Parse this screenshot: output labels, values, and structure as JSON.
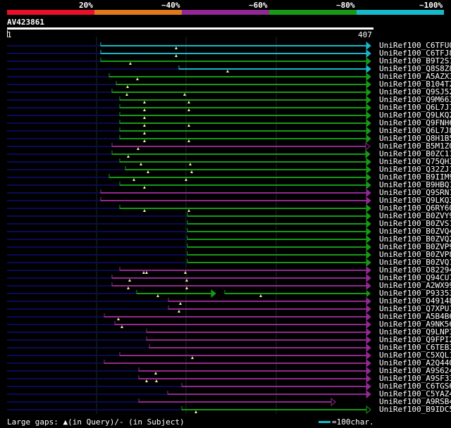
{
  "legend": {
    "items": [
      {
        "label": "20%",
        "color": "#e8102a"
      },
      {
        "label": "~40%",
        "color": "#e07a1a"
      },
      {
        "label": "~60%",
        "color": "#922892"
      },
      {
        "label": "~80%",
        "color": "#169a16"
      },
      {
        "label": "~100%",
        "color": "#17b8c8"
      }
    ]
  },
  "query": {
    "id": "AV423861",
    "start": "1",
    "end": "407"
  },
  "colors": {
    "navy": "#0a0a55",
    "green": "#169a16",
    "purple": "#922892",
    "cyan": "#17b8c8",
    "marker": "#f0f0a0"
  },
  "hits": [
    {
      "name": "UniRef100_C6TFU0",
      "color": "cyan",
      "start": 143,
      "markers": [
        250
      ]
    },
    {
      "name": "UniRef100_C6TFJ8",
      "color": "cyan",
      "start": 143,
      "markers": [
        250
      ]
    },
    {
      "name": "UniRef100_B9T2S1",
      "color": "green",
      "start": 143,
      "markers": [
        185
      ]
    },
    {
      "name": "UniRef100_Q8S8Z8",
      "color": "cyan",
      "start": 254,
      "markers": [
        323
      ]
    },
    {
      "name": "UniRef100_A5AZX3",
      "color": "green",
      "start": 155,
      "markers": [
        195
      ]
    },
    {
      "name": "UniRef100_B104T2",
      "color": "green",
      "start": 165,
      "markers": [
        181
      ]
    },
    {
      "name": "UniRef100_Q9SJ52",
      "color": "green",
      "start": 159,
      "markers": [
        180,
        262
      ]
    },
    {
      "name": "UniRef100_Q9M663",
      "color": "green",
      "start": 170,
      "markers": [
        205,
        268
      ]
    },
    {
      "name": "UniRef100_Q6L7J7",
      "color": "green",
      "start": 170,
      "markers": [
        205,
        268
      ]
    },
    {
      "name": "UniRef100_Q9LKQ2",
      "color": "green",
      "start": 170,
      "markers": [
        205
      ]
    },
    {
      "name": "UniRef100_Q9FNH6",
      "color": "green",
      "start": 170,
      "markers": [
        205,
        268
      ]
    },
    {
      "name": "UniRef100_Q6L7J8",
      "color": "green",
      "start": 170,
      "markers": [
        205
      ]
    },
    {
      "name": "UniRef100_Q8H1B5",
      "color": "green",
      "start": 170,
      "markers": [
        205,
        268
      ]
    },
    {
      "name": "UniRef100_B5M1Z0",
      "color": "purple",
      "start": 159,
      "end": 519,
      "open": true,
      "markers": [
        196
      ]
    },
    {
      "name": "UniRef100_B0ZC11",
      "color": "green",
      "start": 159,
      "end": 519,
      "markers": [
        182
      ]
    },
    {
      "name": "UniRef100_Q75QH3",
      "color": "green",
      "start": 170,
      "markers": [
        200,
        270
      ]
    },
    {
      "name": "UniRef100_Q32ZJ1",
      "color": "green",
      "start": 178,
      "markers": [
        210,
        272
      ]
    },
    {
      "name": "UniRef100_B9IIM9",
      "color": "green",
      "start": 155,
      "markers": [
        190,
        264
      ]
    },
    {
      "name": "UniRef100_B9HBQ1",
      "color": "green",
      "start": 170,
      "markers": [
        205
      ]
    },
    {
      "name": "UniRef100_Q9SRN1",
      "color": "purple",
      "start": 143,
      "markers": []
    },
    {
      "name": "UniRef100_Q9LKQ3",
      "color": "purple",
      "start": 143,
      "markers": []
    },
    {
      "name": "UniRef100_Q6RY60",
      "color": "green",
      "start": 170,
      "markers": [
        205,
        268
      ]
    },
    {
      "name": "UniRef100_B0ZVY9",
      "color": "green",
      "start": 266,
      "markers": []
    },
    {
      "name": "UniRef100_B0ZVS1",
      "color": "green",
      "start": 266,
      "markers": []
    },
    {
      "name": "UniRef100_B0ZVQ4",
      "color": "green",
      "start": 266,
      "markers": []
    },
    {
      "name": "UniRef100_B0ZVQ2",
      "color": "green",
      "start": 266,
      "markers": []
    },
    {
      "name": "UniRef100_B0ZVP9",
      "color": "green",
      "start": 266,
      "markers": []
    },
    {
      "name": "UniRef100_B0ZVP8",
      "color": "green",
      "start": 266,
      "markers": []
    },
    {
      "name": "UniRef100_B0ZVQ1",
      "color": "green",
      "start": 266,
      "markers": []
    },
    {
      "name": "UniRef100_O82294",
      "color": "purple",
      "start": 170,
      "markers": [
        204,
        208,
        263
      ]
    },
    {
      "name": "UniRef100_Q94CU7",
      "color": "purple",
      "start": 159,
      "markers": [
        184,
        265
      ]
    },
    {
      "name": "UniRef100_A2WX99",
      "color": "purple",
      "start": 159,
      "markers": [
        182,
        265
      ]
    },
    {
      "name": "UniRef100_P93353",
      "color": "green",
      "start": 194,
      "end": 300,
      "seg2start": 319,
      "markers": [
        224,
        370
      ]
    },
    {
      "name": "UniRef100_O49148",
      "color": "purple",
      "start": 239,
      "markers": [
        256
      ]
    },
    {
      "name": "UniRef100_Q7XPU1",
      "color": "purple",
      "start": 239,
      "markers": [
        254
      ]
    },
    {
      "name": "UniRef100_A5B4B6",
      "color": "purple",
      "start": 148,
      "markers": [
        168
      ]
    },
    {
      "name": "UniRef100_A9NK56",
      "color": "purple",
      "start": 163,
      "markers": [
        173
      ]
    },
    {
      "name": "UniRef100_Q9LNP3",
      "color": "purple",
      "start": 208,
      "markers": []
    },
    {
      "name": "UniRef100_Q9FPI2",
      "color": "purple",
      "start": 208,
      "markers": []
    },
    {
      "name": "UniRef100_C6TEB3",
      "color": "purple",
      "start": 212,
      "markers": []
    },
    {
      "name": "UniRef100_C5XQL1",
      "color": "purple",
      "start": 170,
      "markers": [
        273
      ]
    },
    {
      "name": "UniRef100_A2Q44O",
      "color": "purple",
      "start": 148,
      "markers": []
    },
    {
      "name": "UniRef100_A9S624",
      "color": "purple",
      "start": 197,
      "markers": [
        221
      ]
    },
    {
      "name": "UniRef100_A9SF33",
      "color": "purple",
      "start": 197,
      "markers": [
        208,
        222
      ]
    },
    {
      "name": "UniRef100_C6TGS6",
      "color": "purple",
      "start": 258,
      "markers": []
    },
    {
      "name": "UniRef100_C5YAZ4",
      "color": "purple",
      "start": 238,
      "markers": []
    },
    {
      "name": "UniRef100_A9RSB4",
      "color": "purple",
      "start": 197,
      "end": 470,
      "open": true,
      "markers": []
    },
    {
      "name": "UniRef100_B9IDC5",
      "color": "green",
      "start": 258,
      "markers": [
        278
      ],
      "open": true
    }
  ],
  "footer": {
    "gaps_text": "Large gaps: ▲(in Query)/- (in Subject)",
    "scale_text": "=100char."
  }
}
